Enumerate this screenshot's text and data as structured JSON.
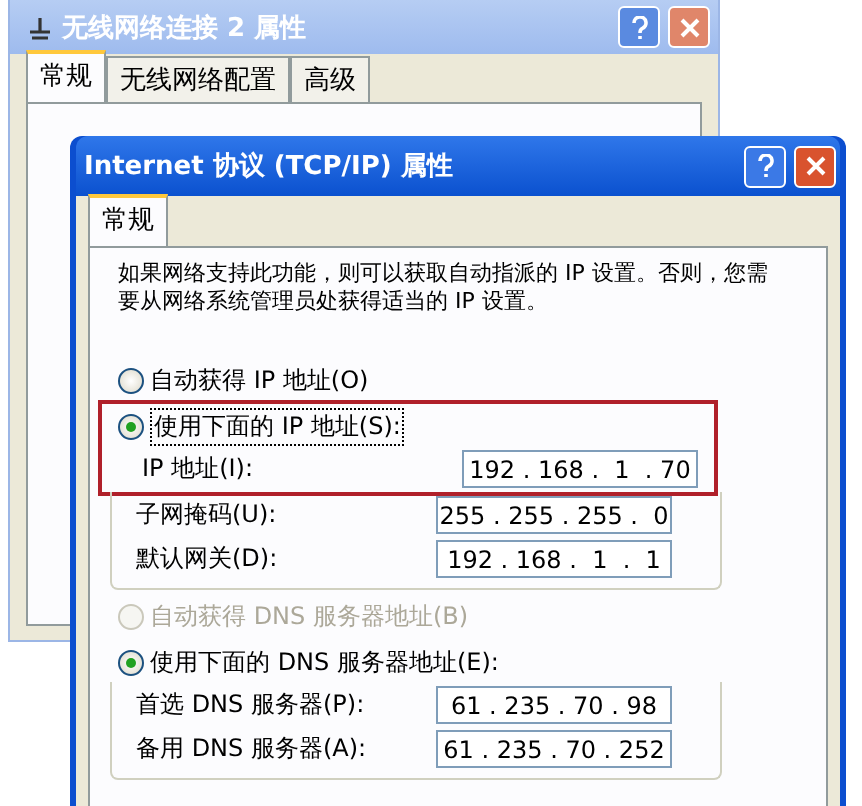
{
  "background_window": {
    "title": "无线网络连接 2 属性",
    "tabs": [
      {
        "label": "常规",
        "selected": true
      },
      {
        "label": "无线网络配置",
        "selected": false
      },
      {
        "label": "高级",
        "selected": false
      }
    ]
  },
  "dialog": {
    "title": "Internet 协议 (TCP/IP) 属性",
    "tabs": [
      {
        "label": "常规",
        "selected": true
      }
    ],
    "description": "如果网络支持此功能，则可以获取自动指派的 IP 设置。否则，您需要从网络系统管理员处获得适当的 IP 设置。",
    "highlight_box": true,
    "ip_options": [
      {
        "label": "自动获得 IP 地址(O)",
        "selected": false,
        "disabled": false
      },
      {
        "label": "使用下面的 IP 地址(S):",
        "selected": true,
        "disabled": false
      }
    ],
    "ip_fields": [
      {
        "label": "IP 地址(I):",
        "value": "192 . 168 .  1  . 70"
      },
      {
        "label": "子网掩码(U):",
        "value": "255 . 255 . 255 .  0"
      },
      {
        "label": "默认网关(D):",
        "value": "192 . 168 .  1  .  1"
      }
    ],
    "dns_options": [
      {
        "label": "自动获得 DNS 服务器地址(B)",
        "selected": false,
        "disabled": true
      },
      {
        "label": "使用下面的 DNS 服务器地址(E):",
        "selected": true,
        "disabled": false
      }
    ],
    "dns_fields": [
      {
        "label": "首选 DNS 服务器(P):",
        "value": "61 . 235 . 70 . 98"
      },
      {
        "label": "备用 DNS 服务器(A):",
        "value": "61 . 235 . 70 . 252"
      }
    ]
  }
}
